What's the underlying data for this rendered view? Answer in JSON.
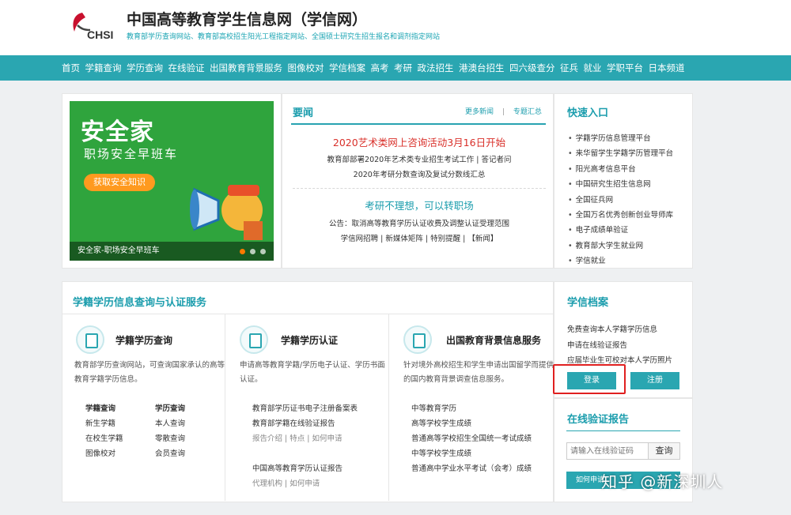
{
  "header": {
    "logo_text": "CHSI",
    "title": "中国高等教育学生信息网（学信网）",
    "subtitle": "教育部学历查询网站、教育部高校招生阳光工程指定网站、全国硕士研究生招生报名和调剂指定网站"
  },
  "nav": {
    "items": [
      "首页",
      "学籍查询",
      "学历查询",
      "在线验证",
      "出国教育背景服务",
      "图像校对",
      "学信档案",
      "高考",
      "考研",
      "政法招生",
      "港澳台招生",
      "四六级查分",
      "征兵",
      "就业",
      "学职平台",
      "日本频道"
    ]
  },
  "banner": {
    "title": "安全家",
    "subtitle": "职场安全早班车",
    "button": "获取安全知识",
    "caption": "安全家-职场安全早班车"
  },
  "news": {
    "title": "要闻",
    "more_label": "更多新闻",
    "topics_label": "专题汇总",
    "headline1": "2020艺术类网上咨询活动3月16日开始",
    "row1": "教育部部署2020年艺术类专业招生考试工作 | 答记者问",
    "row2": "2020年考研分数查询及复试分数线汇总",
    "headline2": "考研不理想，可以转职场",
    "row3": "公告：取消高等教育学历认证收费及调整认证受理范围",
    "row4": "学信网招聘 | 新媒体矩阵 | 特别提醒 | 【新闻】"
  },
  "quick": {
    "title": "快速入口",
    "items": [
      "学籍学历信息管理平台",
      "来华留学生学籍学历管理平台",
      "阳光高考信息平台",
      "中国研究生招生信息网",
      "全国征兵网",
      "全国万名优秀创新创业导师库",
      "电子成绩单验证",
      "教育部大学生就业网",
      "学信就业"
    ]
  },
  "services": {
    "title": "学籍学历信息查询与认证服务",
    "col1": {
      "name": "学籍学历查询",
      "desc": "教育部学历查询网站，可查询国家承认的高等教育学籍学历信息。",
      "left_links": [
        "学籍查询",
        "新生学籍",
        "在校生学籍",
        "图像校对"
      ],
      "right_links": [
        "学历查询",
        "本人查询",
        "零散查询",
        "会员查询"
      ]
    },
    "col2": {
      "name": "学籍学历认证",
      "desc": "申请高等教育学籍/学历电子认证、学历书面认证。",
      "link1": "教育部学历证书电子注册备案表",
      "link2": "教育部学籍在线验证报告",
      "sub1": "报告介绍 | 特点 | 如何申请",
      "link3": "中国高等教育学历认证报告",
      "sub2": "代理机构 | 如何申请"
    },
    "col3": {
      "name": "出国教育背景信息服务",
      "desc": "针对境外高校招生和学生申请出国留学而提供的国内教育背景调查信息服务。",
      "links": [
        "中等教育学历",
        "高等学校学生成绩",
        "普通高等学校招生全国统一考试成绩",
        "中等学校学生成绩",
        "普通高中学业水平考试（会考）成绩"
      ]
    }
  },
  "archive": {
    "title": "学信档案",
    "items": [
      "免费查询本人学籍学历信息",
      "申请在线验证报告",
      "应届毕业生可校对本人学历照片"
    ],
    "login": "登录",
    "register": "注册"
  },
  "verify": {
    "title": "在线验证报告",
    "placeholder": "请输入在线验证码",
    "button": "查询",
    "how": "如何申请"
  },
  "watermark": "知乎 @新深圳人",
  "colors": {
    "accent": "#2aa6b1",
    "highlight": "#e02020",
    "banner": "#2fa43d"
  }
}
